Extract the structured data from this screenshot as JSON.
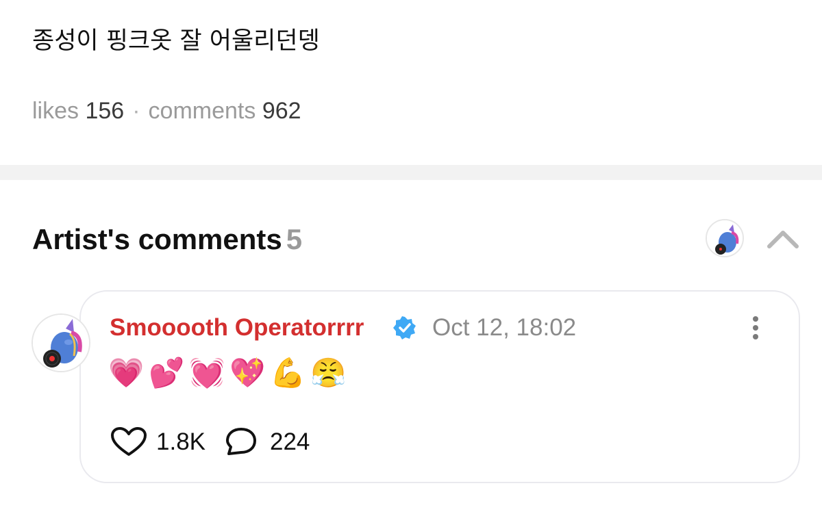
{
  "post": {
    "text": "종성이 핑크옷 잘 어울리던뎅",
    "likes_label": "likes",
    "likes_count": "156",
    "separator": "·",
    "comments_label": "comments",
    "comments_count": "962"
  },
  "artist_comments": {
    "title": "Artist's comments",
    "count": "5",
    "collapse_icon": "chevron-up-icon",
    "comment": {
      "author": "Smooooth Operatorrrr",
      "verified_icon": "verified-badge-icon",
      "timestamp": "Oct 12, 18:02",
      "emojis": [
        "💗",
        "💕",
        "💓",
        "💖",
        "💪",
        "😤"
      ],
      "likes": "1.8K",
      "replies": "224",
      "like_icon": "heart-icon",
      "reply_icon": "speech-bubble-icon",
      "more_icon": "more-vertical-icon"
    }
  },
  "colors": {
    "author_name": "#d32f2f",
    "verified_badge": "#3fa9f5",
    "muted_text": "#9a9a9a"
  }
}
